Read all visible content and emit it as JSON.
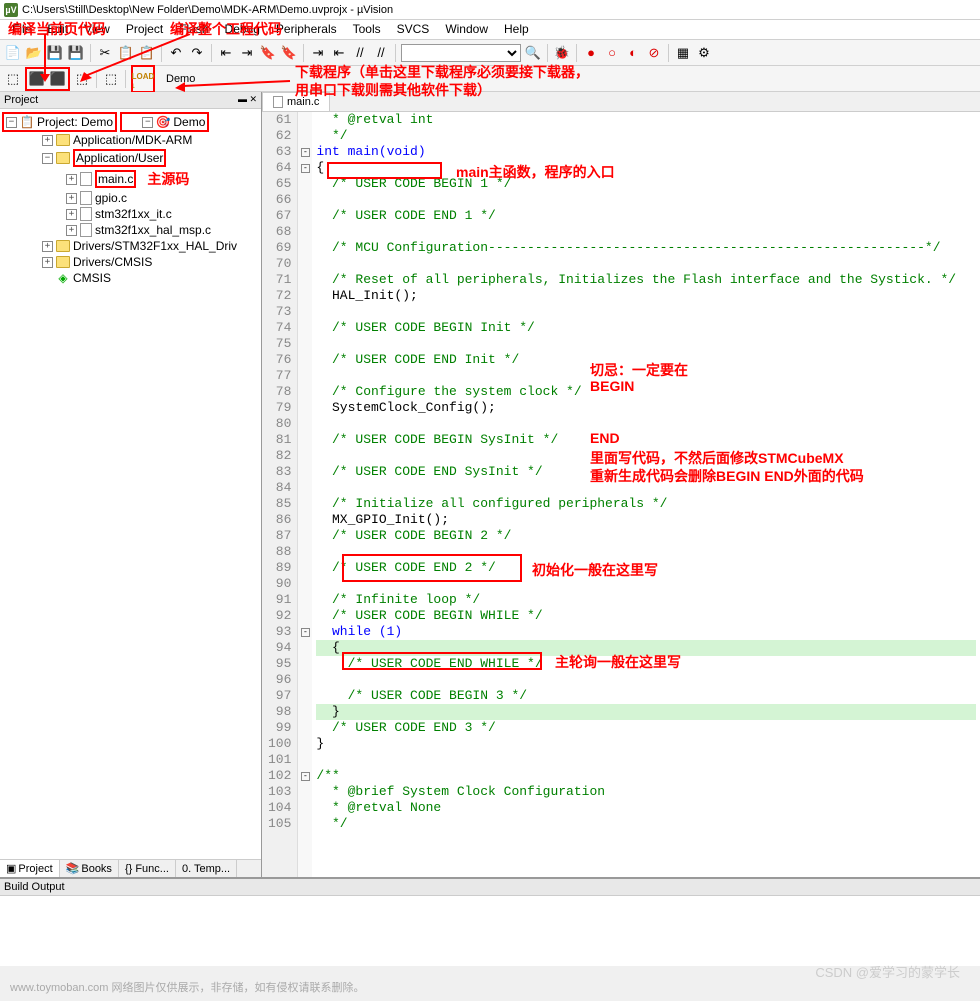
{
  "window": {
    "title": "C:\\Users\\Still\\Desktop\\New Folder\\Demo\\MDK-ARM\\Demo.uvprojx - µVision"
  },
  "menu": {
    "items": [
      "File",
      "Edit",
      "View",
      "Project",
      "Flash",
      "Debug",
      "Peripherals",
      "Tools",
      "SVCS",
      "Window",
      "Help"
    ]
  },
  "annotations": {
    "compile_current": "编译当前页代码",
    "compile_all": "编译整个工程代码",
    "download1": "下载程序（单击这里下载程序必须要接下载器，",
    "download2": "用串口下载则需其他软件下载）",
    "target": "Demo",
    "main_source": "主源码",
    "main_func": "main主函数，程序的入口",
    "warn_title": "切忌：一定要在",
    "warn_begin": "BEGIN",
    "warn_end": "END",
    "warn_body1": "里面写代码，不然后面修改STMCubeMX",
    "warn_body2": "重新生成代码会删除BEGIN  END外面的代码",
    "init_here": "初始化一般在这里写",
    "loop_here": "主轮询一般在这里写"
  },
  "project_panel": {
    "title": "Project",
    "tree": {
      "root": "Project: Demo",
      "target": "Demo",
      "g1": "Application/MDK-ARM",
      "g2": "Application/User",
      "files": [
        "main.c",
        "gpio.c",
        "stm32f1xx_it.c",
        "stm32f1xx_hal_msp.c"
      ],
      "g3": "Drivers/STM32F1xx_HAL_Driv",
      "g4": "Drivers/CMSIS",
      "g5": "CMSIS"
    },
    "tabs": [
      "Project",
      "Books",
      "{} Func...",
      "0. Temp..."
    ]
  },
  "editor": {
    "file_tab": "main.c",
    "lines": [
      {
        "n": 61,
        "t": "  * @retval int",
        "cls": "cm"
      },
      {
        "n": 62,
        "t": "  */",
        "cls": "cm"
      },
      {
        "n": 63,
        "t": "int main(void)",
        "cls": "kw",
        "fold": "-"
      },
      {
        "n": 64,
        "t": "{",
        "fold": "-"
      },
      {
        "n": 65,
        "t": "  /* USER CODE BEGIN 1 */",
        "cls": "cm"
      },
      {
        "n": 66,
        "t": ""
      },
      {
        "n": 67,
        "t": "  /* USER CODE END 1 */",
        "cls": "cm"
      },
      {
        "n": 68,
        "t": ""
      },
      {
        "n": 69,
        "t": "  /* MCU Configuration--------------------------------------------------------*/",
        "cls": "cm"
      },
      {
        "n": 70,
        "t": ""
      },
      {
        "n": 71,
        "t": "  /* Reset of all peripherals, Initializes the Flash interface and the Systick. */",
        "cls": "cm"
      },
      {
        "n": 72,
        "t": "  HAL_Init();"
      },
      {
        "n": 73,
        "t": ""
      },
      {
        "n": 74,
        "t": "  /* USER CODE BEGIN Init */",
        "cls": "cm"
      },
      {
        "n": 75,
        "t": ""
      },
      {
        "n": 76,
        "t": "  /* USER CODE END Init */",
        "cls": "cm"
      },
      {
        "n": 77,
        "t": ""
      },
      {
        "n": 78,
        "t": "  /* Configure the system clock */",
        "cls": "cm"
      },
      {
        "n": 79,
        "t": "  SystemClock_Config();"
      },
      {
        "n": 80,
        "t": ""
      },
      {
        "n": 81,
        "t": "  /* USER CODE BEGIN SysInit */",
        "cls": "cm"
      },
      {
        "n": 82,
        "t": ""
      },
      {
        "n": 83,
        "t": "  /* USER CODE END SysInit */",
        "cls": "cm"
      },
      {
        "n": 84,
        "t": ""
      },
      {
        "n": 85,
        "t": "  /* Initialize all configured peripherals */",
        "cls": "cm"
      },
      {
        "n": 86,
        "t": "  MX_GPIO_Init();"
      },
      {
        "n": 87,
        "t": "  /* USER CODE BEGIN 2 */",
        "cls": "cm"
      },
      {
        "n": 88,
        "t": ""
      },
      {
        "n": 89,
        "t": "  /* USER CODE END 2 */",
        "cls": "cm"
      },
      {
        "n": 90,
        "t": ""
      },
      {
        "n": 91,
        "t": "  /* Infinite loop */",
        "cls": "cm"
      },
      {
        "n": 92,
        "t": "  /* USER CODE BEGIN WHILE */",
        "cls": "cm"
      },
      {
        "n": 93,
        "t": "  while (1)",
        "cls": "kw",
        "fold": "-"
      },
      {
        "n": 94,
        "t": "  {",
        "hl": true
      },
      {
        "n": 95,
        "t": "    /* USER CODE END WHILE */",
        "cls": "cm"
      },
      {
        "n": 96,
        "t": ""
      },
      {
        "n": 97,
        "t": "    /* USER CODE BEGIN 3 */",
        "cls": "cm"
      },
      {
        "n": 98,
        "t": "  }",
        "hl": true
      },
      {
        "n": 99,
        "t": "  /* USER CODE END 3 */",
        "cls": "cm"
      },
      {
        "n": 100,
        "t": "}"
      },
      {
        "n": 101,
        "t": ""
      },
      {
        "n": 102,
        "t": "/**",
        "cls": "cm",
        "fold": "-"
      },
      {
        "n": 103,
        "t": "  * @brief System Clock Configuration",
        "cls": "cm"
      },
      {
        "n": 104,
        "t": "  * @retval None",
        "cls": "cm"
      },
      {
        "n": 105,
        "t": "  */",
        "cls": "cm"
      }
    ]
  },
  "build_output": {
    "title": "Build Output"
  },
  "footer": "www.toymoban.com  网络图片仅供展示，非存储，如有侵权请联系删除。",
  "watermark": "CSDN @爱学习的蒙学长"
}
